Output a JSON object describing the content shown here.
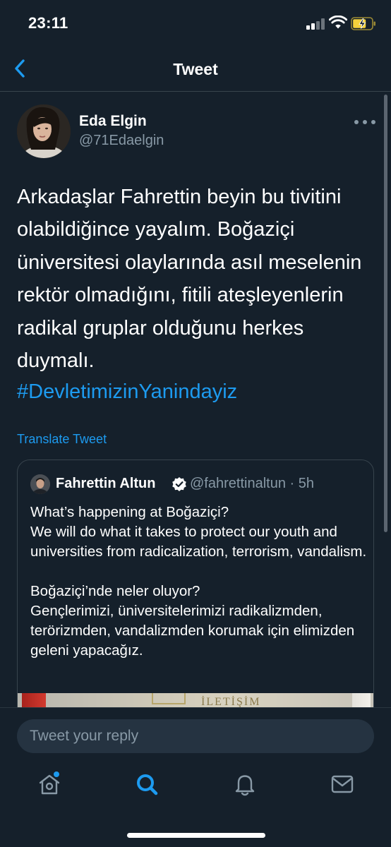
{
  "status_bar": {
    "time": "23:11"
  },
  "header": {
    "title": "Tweet"
  },
  "tweet": {
    "author_name": "Eda Elgin",
    "author_handle": "@71Edaelgin",
    "text": "Arkadaşlar Fahrettin beyin bu tivitini olabildiğince yayalım. Boğaziçi üniversitesi olaylarında asıl meselenin rektör olmadığını, fitili ateşleyenlerin radikal gruplar olduğunu herkes duymalı.",
    "hashtag": "#DevletimizinYanindayiz",
    "translate_label": "Translate Tweet"
  },
  "quoted_tweet": {
    "author_name": "Fahrettin Altun",
    "handle_and_time": "@fahrettinaltun · 5h",
    "body_en_1": "What’s happening at Boğaziçi?",
    "body_en_2": "We will do what it takes to protect our youth and universities from radicalization, terrorism, vandalism.",
    "body_tr_1": "Boğaziçi’nde neler oluyor?",
    "body_tr_2": "Gençlerimizi, üniversitelerimizi radikalizmden, terörizmden, vandalizmden korumak için elimizden geleni yapacağız.",
    "image_sign": "İLETİŞİM"
  },
  "reply": {
    "placeholder": "Tweet your reply"
  },
  "tab_bar": {
    "items": [
      "home-icon",
      "search-icon",
      "notifications-icon",
      "messages-icon"
    ],
    "active": "search-icon",
    "home_has_new_dot": true
  },
  "colors": {
    "background": "#15202b",
    "accent": "#1d9bf0",
    "secondary_text": "#8899a6",
    "border": "#38444d",
    "input_bg": "#253341",
    "battery": "#f5d23c"
  }
}
